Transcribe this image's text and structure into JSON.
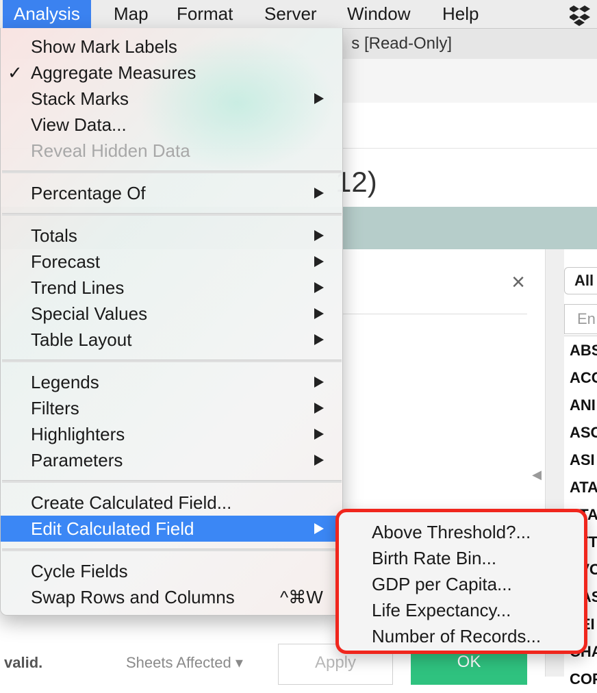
{
  "menubar": {
    "items": [
      "Analysis",
      "Map",
      "Format",
      "Server",
      "Window",
      "Help"
    ],
    "active": "Analysis",
    "dropbox_icon": "dropbox-icon"
  },
  "window": {
    "title": "s [Read-Only]",
    "heading_fragment": "12)"
  },
  "analysis_menu": {
    "groups": [
      [
        {
          "label": "Show Mark Labels"
        },
        {
          "label": "Aggregate Measures",
          "checked": true
        },
        {
          "label": "Stack Marks",
          "submenu": true
        },
        {
          "label": "View Data..."
        },
        {
          "label": "Reveal Hidden Data",
          "disabled": true
        }
      ],
      [
        {
          "label": "Percentage Of",
          "submenu": true
        }
      ],
      [
        {
          "label": "Totals",
          "submenu": true
        },
        {
          "label": "Forecast",
          "submenu": true
        },
        {
          "label": "Trend Lines",
          "submenu": true
        },
        {
          "label": "Special Values",
          "submenu": true
        },
        {
          "label": "Table Layout",
          "submenu": true
        }
      ],
      [
        {
          "label": "Legends",
          "submenu": true
        },
        {
          "label": "Filters",
          "submenu": true
        },
        {
          "label": "Highlighters",
          "submenu": true
        },
        {
          "label": "Parameters",
          "submenu": true
        }
      ],
      [
        {
          "label": "Create Calculated Field..."
        },
        {
          "label": "Edit Calculated Field",
          "submenu": true,
          "highlighted": true
        }
      ],
      [
        {
          "label": "Cycle Fields"
        },
        {
          "label": "Swap Rows and Columns",
          "shortcut": "^⌘W"
        }
      ]
    ]
  },
  "calc_submenu": {
    "highlight_color": "#f0261d",
    "items": [
      "Above Threshold?...",
      "Birth Rate Bin...",
      "GDP per Capita...",
      "Life Expectancy...",
      "Number of Records..."
    ]
  },
  "filter_panel": {
    "select_value": "All",
    "search_placeholder": "En",
    "items": [
      "ABS",
      "ACC",
      "ANI",
      "ASC",
      "ASI",
      "ATA",
      "ATA",
      "ATT",
      "AVO",
      "BAS",
      "BEI",
      "CHA",
      "COF"
    ]
  },
  "footer": {
    "status": "valid.",
    "sheets_affected": "Sheets Affected ▾",
    "apply_label": "Apply",
    "ok_label": "OK",
    "ok_color": "#2fc27f",
    "close_label": "×",
    "collapse_glyph": "◀"
  }
}
